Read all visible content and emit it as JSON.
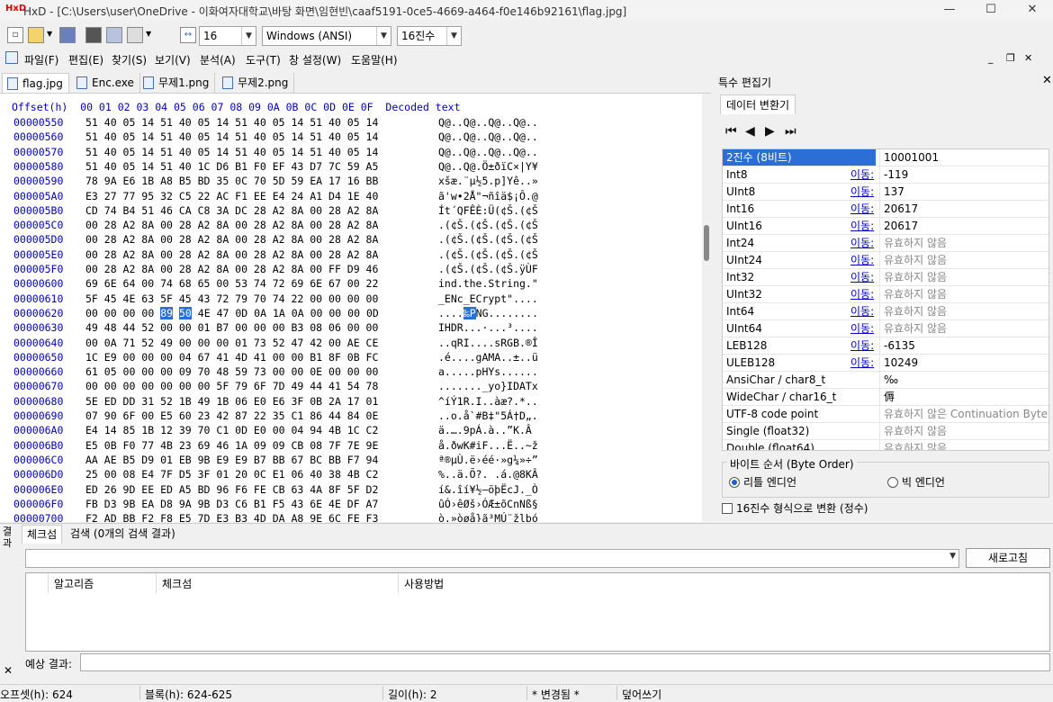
{
  "window": {
    "app_icon": "HxD",
    "title": "HxD - [C:\\Users\\user\\OneDrive - 이화여자대학교\\바탕 화면\\임현빈\\caaf5191-0ce5-4669-a464-f0e146b92161\\flag.jpg]",
    "minimize": "—",
    "maximize": "☐",
    "close": "✕"
  },
  "toolbar": {
    "bytes_per_row": "16",
    "charset": "Windows (ANSI)",
    "offset_base": "16진수"
  },
  "menu": [
    "파일(F)",
    "편집(E)",
    "찾기(S)",
    "보기(V)",
    "분석(A)",
    "도구(T)",
    "창 설정(W)",
    "도움말(H)"
  ],
  "tabs": [
    {
      "label": "flag.jpg",
      "active": true
    },
    {
      "label": "Enc.exe",
      "active": false
    },
    {
      "label": "무제1.png",
      "active": false
    },
    {
      "label": "무제2.png",
      "active": false
    }
  ],
  "hex": {
    "header": "Offset(h)  00 01 02 03 04 05 06 07 08 09 0A 0B 0C 0D 0E 0F  Decoded text",
    "rows": [
      {
        "off": "00000550",
        "hex": "51 40 05 14 51 40 05 14 51 40 05 14 51 40 05 14",
        "txt": "Q@..Q@..Q@..Q@.."
      },
      {
        "off": "00000560",
        "hex": "51 40 05 14 51 40 05 14 51 40 05 14 51 40 05 14",
        "txt": "Q@..Q@..Q@..Q@.."
      },
      {
        "off": "00000570",
        "hex": "51 40 05 14 51 40 05 14 51 40 05 14 51 40 05 14",
        "txt": "Q@..Q@..Q@..Q@.."
      },
      {
        "off": "00000580",
        "hex": "51 40 05 14 51 40 1C D6 B1 F0 EF 43 D7 7C 59 A5",
        "txt": "Q@..Q@.Ö±ðïC×|Y¥"
      },
      {
        "off": "00000590",
        "hex": "78 9A E6 1B A8 B5 BD 35 0C 70 5D 59 EA 17 16 BB",
        "txt": "xšæ.¨µ½5.p]Yê..»"
      },
      {
        "off": "000005A0",
        "hex": "E3 27 77 95 32 C5 22 AC F1 EE E4 24 A1 D4 1E 40",
        "txt": "ã'w•2Å\"¬ñîä$¡Ô.@"
      },
      {
        "off": "000005B0",
        "hex": "CD 74 B4 51 46 CA C8 3A DC 28 A2 8A 00 28 A2 8A",
        "txt": "Ít´QFÊÈ:Ü(¢Š.(¢Š"
      },
      {
        "off": "000005C0",
        "hex": "00 28 A2 8A 00 28 A2 8A 00 28 A2 8A 00 28 A2 8A",
        "txt": ".(¢Š.(¢Š.(¢Š.(¢Š"
      },
      {
        "off": "000005D0",
        "hex": "00 28 A2 8A 00 28 A2 8A 00 28 A2 8A 00 28 A2 8A",
        "txt": ".(¢Š.(¢Š.(¢Š.(¢Š"
      },
      {
        "off": "000005E0",
        "hex": "00 28 A2 8A 00 28 A2 8A 00 28 A2 8A 00 28 A2 8A",
        "txt": ".(¢Š.(¢Š.(¢Š.(¢Š"
      },
      {
        "off": "000005F0",
        "hex": "00 28 A2 8A 00 28 A2 8A 00 28 A2 8A 00 FF D9 46",
        "txt": ".(¢Š.(¢Š.(¢Š.ÿÙF"
      },
      {
        "off": "00000600",
        "hex": "69 6E 64 00 74 68 65 00 53 74 72 69 6E 67 00 22",
        "txt": "ind.the.String.\""
      },
      {
        "off": "00000610",
        "hex": "5F 45 4E 63 5F 45 43 72 79 70 74 22 00 00 00 00",
        "txt": "_ENc_ECrypt\"...."
      },
      {
        "off": "00000620",
        "hex": "00 00 00 00 89 50 4E 47 0D 0A 1A 0A 00 00 00 0D",
        "txt": "....‰PNG........"
      },
      {
        "off": "00000630",
        "hex": "49 48 44 52 00 00 01 B7 00 00 00 B3 08 06 00 00",
        "txt": "IHDR...·...³...."
      },
      {
        "off": "00000640",
        "hex": "00 0A 71 52 49 00 00 00 01 73 52 47 42 00 AE CE",
        "txt": "..qRI....sRGB.®Î"
      },
      {
        "off": "00000650",
        "hex": "1C E9 00 00 00 04 67 41 4D 41 00 00 B1 8F 0B FC",
        "txt": ".é....gAMA..±..ü"
      },
      {
        "off": "00000660",
        "hex": "61 05 00 00 00 09 70 48 59 73 00 00 0E 00 00 00",
        "txt": "a.....pHYs......"
      },
      {
        "off": "00000670",
        "hex": "00 00 00 00 00 00 00 5F 79 6F 7D 49 44 41 54 78",
        "txt": "......._yo}IDATx"
      },
      {
        "off": "00000680",
        "hex": "5E ED DD 31 52 1B 49 1B 06 E0 E6 3F 0B 2A 17 01",
        "txt": "^íÝ1R.I..àæ?.*.."
      },
      {
        "off": "00000690",
        "hex": "07 90 6F 00 E5 60 23 42 87 22 35 C1 86 44 84 0E",
        "txt": "..o.å`#B‡\"5Á†D„."
      },
      {
        "off": "000006A0",
        "hex": "E4 14 85 1B 12 39 70 C1 0D E0 00 04 94 4B 1C C2",
        "txt": "ä.….9pÁ.à..”K.Â"
      },
      {
        "off": "000006B0",
        "hex": "E5 0B F0 77 4B 23 69 46 1A 09 09 CB 08 7F 7E 9E",
        "txt": "å.ðwK#iF...Ë..~ž"
      },
      {
        "off": "000006C0",
        "hex": "AA AE B5 D9 01 EB 9B E9 E9 B7 BB 67 BC BB F7 94",
        "txt": "ª®µÙ.ë›éé·»g¼»÷”"
      },
      {
        "off": "000006D0",
        "hex": "25 00 08 E4 7F D5 3F 01 20 0C E1 06 40 38 4B C2",
        "txt": "%..ä.Õ?. .á.@8KÂ"
      },
      {
        "off": "000006E0",
        "hex": "ED 26 9D EE ED A5 BD 96 F6 FE CB 63 4A 8F 5F D2",
        "txt": "í&.îí¥½–öþËcJ._Ò"
      },
      {
        "off": "000006F0",
        "hex": "FB D3 9B EA D8 9A 9B D3 C6 B1 F5 43 6E 4E DF A7",
        "txt": "ûÓ›êØš›ÓÆ±õCnNß§"
      },
      {
        "off": "00000700",
        "hex": "F2 AD BB F2 F8 E5 7D E3 B3 4D DA A8 9E 6C FE F3",
        "txt": "ò.»òøå}ã³MÚ¨žlþó"
      }
    ],
    "selected_row": 13,
    "selected_bytes": [
      4,
      5
    ]
  },
  "side": {
    "title": "특수 편집기",
    "tab": "데이터 변환기",
    "nav": [
      "⏮",
      "◀",
      "▶",
      "⏭"
    ],
    "rows": [
      {
        "name": "2진수 (8비트)",
        "link": "",
        "value": "10001001",
        "na": false
      },
      {
        "name": "Int8",
        "link": "이동:",
        "value": "-119",
        "na": false
      },
      {
        "name": "UInt8",
        "link": "이동:",
        "value": "137",
        "na": false
      },
      {
        "name": "Int16",
        "link": "이동:",
        "value": "20617",
        "na": false
      },
      {
        "name": "UInt16",
        "link": "이동:",
        "value": "20617",
        "na": false
      },
      {
        "name": "Int24",
        "link": "이동:",
        "value": "유효하지 않음",
        "na": true
      },
      {
        "name": "UInt24",
        "link": "이동:",
        "value": "유효하지 않음",
        "na": true
      },
      {
        "name": "Int32",
        "link": "이동:",
        "value": "유효하지 않음",
        "na": true
      },
      {
        "name": "UInt32",
        "link": "이동:",
        "value": "유효하지 않음",
        "na": true
      },
      {
        "name": "Int64",
        "link": "이동:",
        "value": "유효하지 않음",
        "na": true
      },
      {
        "name": "UInt64",
        "link": "이동:",
        "value": "유효하지 않음",
        "na": true
      },
      {
        "name": "LEB128",
        "link": "이동:",
        "value": "-6135",
        "na": false
      },
      {
        "name": "ULEB128",
        "link": "이동:",
        "value": "10249",
        "na": false
      },
      {
        "name": "AnsiChar / char8_t",
        "link": "",
        "value": "‰",
        "na": false
      },
      {
        "name": "WideChar / char16_t",
        "link": "",
        "value": "傉",
        "na": false
      },
      {
        "name": "UTF-8 code point",
        "link": "",
        "value": "유효하지 않은 Continuation Byte",
        "na": true
      },
      {
        "name": "Single (float32)",
        "link": "",
        "value": "유효하지 않음",
        "na": true
      },
      {
        "name": "Double (float64)",
        "link": "",
        "value": "유효하지 않음",
        "na": true
      }
    ],
    "byte_order_label": "바이트 순서 (Byte Order)",
    "little_endian": "리틀 엔디언",
    "big_endian": "빅 엔디언",
    "hex_convert": "16진수 형식으로 변환 (정수)"
  },
  "bottom": {
    "side_label": "결과",
    "side_close": "✕",
    "tabs": [
      "체크섬",
      "검색 (0개의 검색 결과)"
    ],
    "refresh": "새로고침",
    "columns": [
      "알고리즘",
      "체크섬",
      "사용방법"
    ],
    "expect_label": "예상 결과:"
  },
  "status": {
    "offset": "오프셋(h): 624",
    "block": "블록(h): 624-625",
    "length": "길이(h): 2",
    "modified": "* 변경됨 *",
    "mode": "덮어쓰기"
  },
  "colors": {
    "accent": "#2b6fd6",
    "offset_blue": "#0000c0",
    "link": "#0000d0"
  }
}
